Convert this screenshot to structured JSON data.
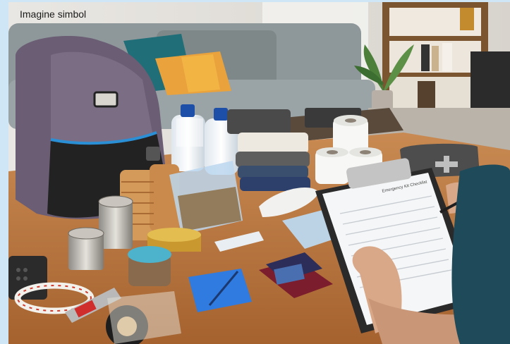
{
  "caption": "Imagine simbol",
  "clipboard_form_title": "Emergency Kit Checklist",
  "colors": {
    "frame": "#cfe6f7",
    "table": "#b9723d",
    "backpack": "#6f6178",
    "sofa": "#8d9596"
  }
}
